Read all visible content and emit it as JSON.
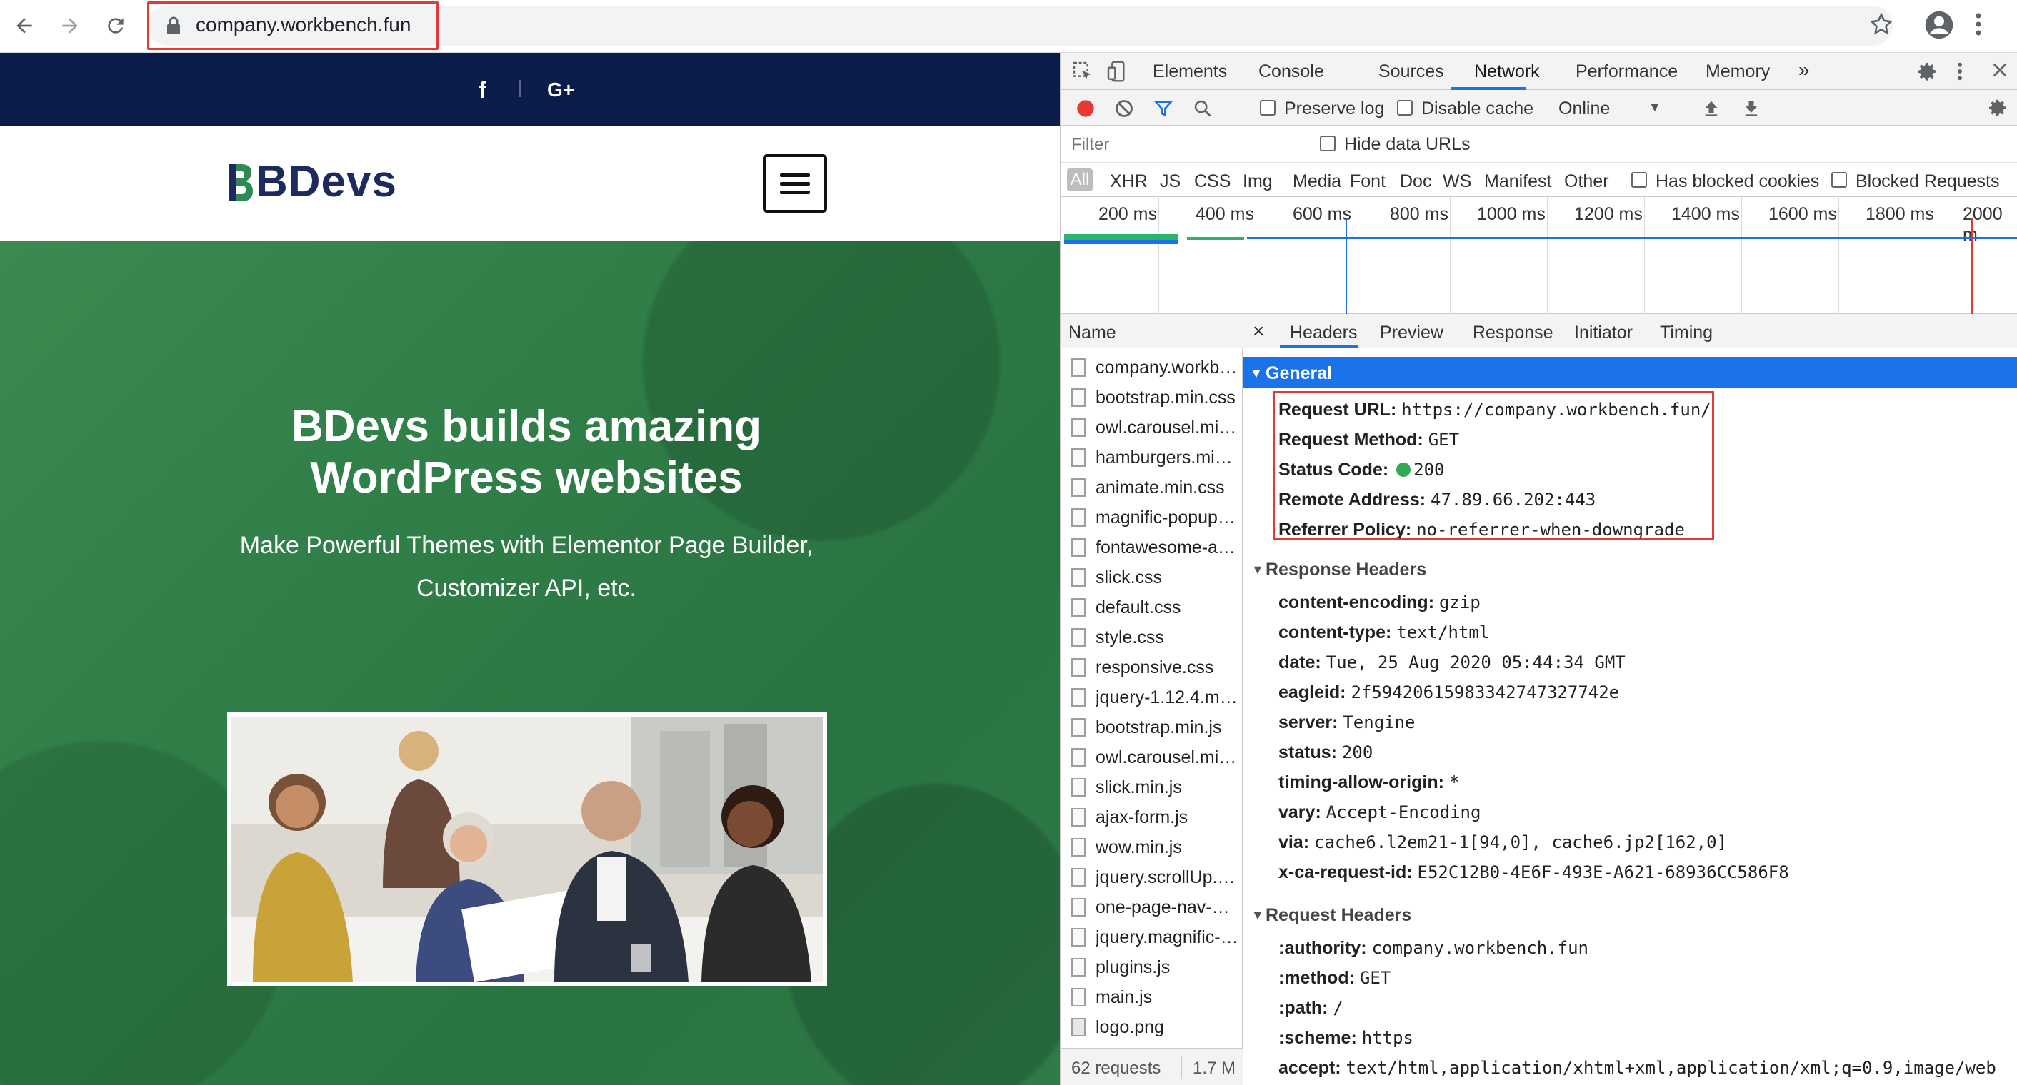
{
  "browser": {
    "url": "company.workbench.fun",
    "colors": {
      "highlight": "#e53935"
    }
  },
  "site": {
    "logo_text": "BDevs",
    "social": {
      "facebook": "f",
      "gplus": "G+"
    },
    "hero_title_line1": "BDevs builds amazing",
    "hero_title_line2": "WordPress websites",
    "hero_subtitle_line1": "Make Powerful Themes with Elementor Page Builder,",
    "hero_subtitle_line2": "Customizer API, etc.",
    "colors": {
      "topbar": "#0b1b4a",
      "hero": "#2f7d47",
      "logo_text": "#1c2a5e"
    }
  },
  "devtools": {
    "tabs": [
      "Elements",
      "Console",
      "Sources",
      "Network",
      "Performance",
      "Memory"
    ],
    "active_tab": "Network",
    "more_tabs": "»",
    "toolbar": {
      "preserve_log": "Preserve log",
      "disable_cache": "Disable cache",
      "throttle": "Online"
    },
    "filter_placeholder": "Filter",
    "hide_data_urls": "Hide data URLs",
    "types": [
      "All",
      "XHR",
      "JS",
      "CSS",
      "Img",
      "Media",
      "Font",
      "Doc",
      "WS",
      "Manifest",
      "Other"
    ],
    "has_blocked_cookies": "Has blocked cookies",
    "blocked_requests": "Blocked Requests",
    "timeline_ticks": [
      "200 ms",
      "400 ms",
      "600 ms",
      "800 ms",
      "1000 ms",
      "1200 ms",
      "1400 ms",
      "1600 ms",
      "1800 ms",
      "2000 m"
    ],
    "name_header": "Name",
    "files": [
      "company.workb…",
      "bootstrap.min.css",
      "owl.carousel.mi…",
      "hamburgers.mi…",
      "animate.min.css",
      "magnific-popup…",
      "fontawesome-a…",
      "slick.css",
      "default.css",
      "style.css",
      "responsive.css",
      "jquery-1.12.4.m…",
      "bootstrap.min.js",
      "owl.carousel.mi…",
      "slick.min.js",
      "ajax-form.js",
      "wow.min.js",
      "jquery.scrollUp.…",
      "one-page-nav-…",
      "jquery.magnific-…",
      "plugins.js",
      "main.js",
      "logo.png"
    ],
    "status": {
      "requests": "62 requests",
      "size": "1.7 M"
    },
    "detail_tabs": [
      "Headers",
      "Preview",
      "Response",
      "Initiator",
      "Timing"
    ],
    "detail_close": "×",
    "general": {
      "title": "General",
      "rows": [
        {
          "k": "Request URL:",
          "v": "https://company.workbench.fun/"
        },
        {
          "k": "Request Method:",
          "v": "GET"
        },
        {
          "k": "Status Code:",
          "v": "200"
        },
        {
          "k": "Remote Address:",
          "v": "47.89.66.202:443"
        },
        {
          "k": "Referrer Policy:",
          "v": "no-referrer-when-downgrade"
        }
      ]
    },
    "response_headers": {
      "title": "Response Headers",
      "rows": [
        {
          "k": "content-encoding:",
          "v": "gzip"
        },
        {
          "k": "content-type:",
          "v": "text/html"
        },
        {
          "k": "date:",
          "v": "Tue, 25 Aug 2020 05:44:34 GMT"
        },
        {
          "k": "eagleid:",
          "v": "2f59420615983342747327742e"
        },
        {
          "k": "server:",
          "v": "Tengine"
        },
        {
          "k": "status:",
          "v": "200"
        },
        {
          "k": "timing-allow-origin:",
          "v": "*"
        },
        {
          "k": "vary:",
          "v": "Accept-Encoding"
        },
        {
          "k": "via:",
          "v": "cache6.l2em21-1[94,0], cache6.jp2[162,0]"
        },
        {
          "k": "x-ca-request-id:",
          "v": "E52C12B0-4E6F-493E-A621-68936CC586F8"
        }
      ]
    },
    "request_headers": {
      "title": "Request Headers",
      "rows": [
        {
          "k": ":authority:",
          "v": "company.workbench.fun"
        },
        {
          "k": ":method:",
          "v": "GET"
        },
        {
          "k": ":path:",
          "v": "/"
        },
        {
          "k": ":scheme:",
          "v": "https"
        },
        {
          "k": "accept:",
          "v": "text/html,application/xhtml+xml,application/xml;q=0.9,image/web"
        }
      ]
    },
    "colors": {
      "accent": "#1a73e8",
      "record": "#e53935",
      "status_ok": "#34a853"
    }
  }
}
